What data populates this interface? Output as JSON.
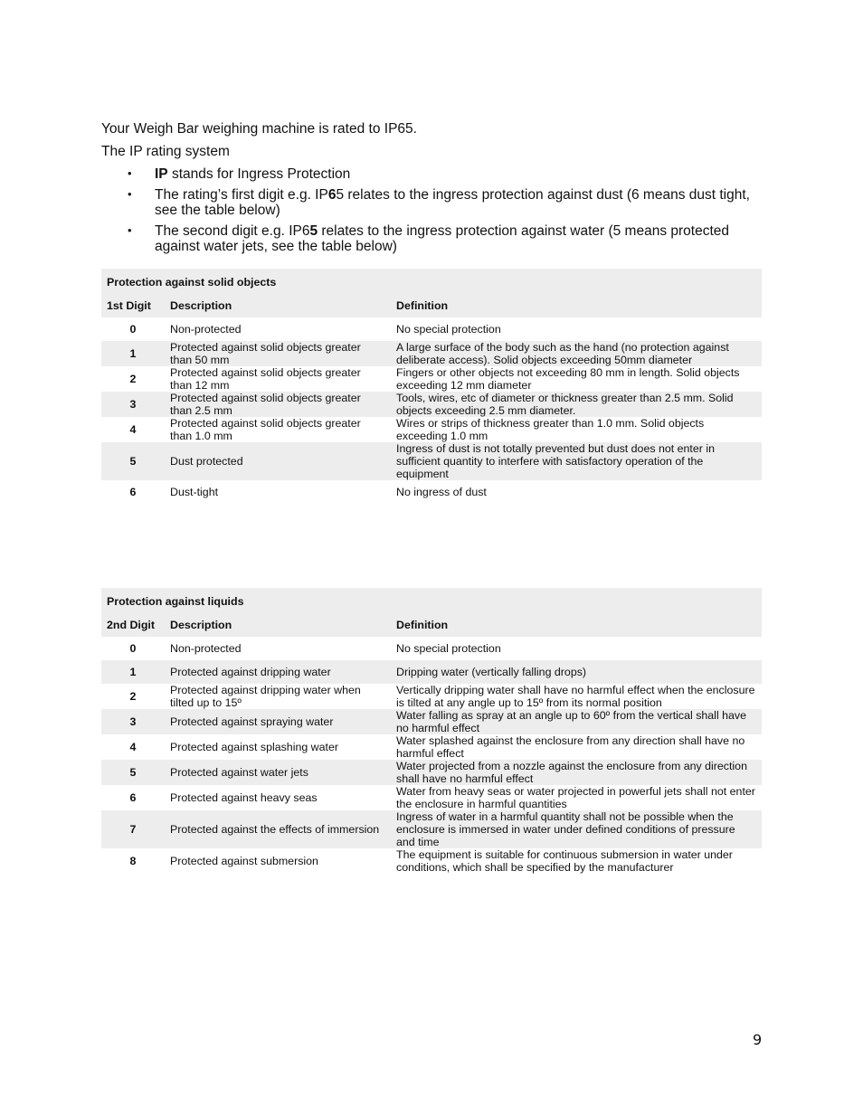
{
  "intro": {
    "line1": "Your Weigh Bar weighing machine is rated to IP65.",
    "line2": "The IP rating system",
    "bullets": [
      {
        "pre": "",
        "bold": "IP",
        "post": " stands for Ingress Protection"
      },
      {
        "pre": "The rating’s first digit e.g. IP",
        "bold": "6",
        "post": "5 relates to the ingress protection against dust (6 means dust tight, see the table below)"
      },
      {
        "pre": "The second digit e.g. IP6",
        "bold": "5",
        "post": " relates to the ingress protection against water (5 means protected against water jets, see the table below)"
      }
    ],
    "bullet_glyph": "•"
  },
  "solids_table": {
    "title": "Protection against solid objects",
    "headers": [
      "1st Digit",
      "Description",
      "Definition"
    ],
    "rows": [
      {
        "digit": "0",
        "description": "Non-protected",
        "definition": "No special protection"
      },
      {
        "digit": "1",
        "description": "Protected against solid objects greater than 50 mm",
        "definition": "A large surface of the body such as the hand (no protection against deliberate access). Solid objects exceeding 50mm diameter"
      },
      {
        "digit": "2",
        "description": "Protected against solid objects greater than 12 mm",
        "definition": "Fingers or other objects not exceeding 80 mm in length. Solid objects exceeding 12 mm diameter"
      },
      {
        "digit": "3",
        "description": "Protected against solid objects greater than 2.5 mm",
        "definition": "Tools, wires, etc of diameter or thickness greater than 2.5 mm. Solid objects exceeding 2.5 mm diameter."
      },
      {
        "digit": "4",
        "description": "Protected against solid objects greater than 1.0 mm",
        "definition": "Wires or strips of thickness greater than 1.0 mm. Solid objects exceeding 1.0 mm"
      },
      {
        "digit": "5",
        "description": "Dust protected",
        "definition": "Ingress of dust is not totally prevented but dust does not enter in sufficient quantity to interfere with satisfactory operation of the equipment"
      },
      {
        "digit": "6",
        "description": "Dust-tight",
        "definition": "No ingress of dust"
      }
    ]
  },
  "liquids_table": {
    "title": "Protection against liquids",
    "headers": [
      "2nd Digit",
      "Description",
      "Definition"
    ],
    "rows": [
      {
        "digit": "0",
        "description": "Non-protected",
        "definition": "No special protection"
      },
      {
        "digit": "1",
        "description": "Protected against dripping water",
        "definition": "Dripping water (vertically falling drops)"
      },
      {
        "digit": "2",
        "description": "Protected against dripping water when tilted up to 15º",
        "definition": "Vertically dripping water shall have no harmful effect when the enclosure is tilted at any angle up to 15º from its normal position"
      },
      {
        "digit": "3",
        "description": "Protected against spraying water",
        "definition": "Water falling as spray at an angle up to 60º  from the vertical shall have no harmful effect"
      },
      {
        "digit": "4",
        "description": "Protected against splashing water",
        "definition": "Water splashed against the enclosure from any direction shall have no harmful effect"
      },
      {
        "digit": "5",
        "description": "Protected against water jets",
        "definition": "Water projected from a nozzle against the enclosure from any direction shall have no harmful effect"
      },
      {
        "digit": "6",
        "description": "Protected against heavy seas",
        "definition": "Water from heavy seas or water projected in powerful jets shall not enter the enclosure in harmful quantities"
      },
      {
        "digit": "7",
        "description": "Protected against the effects of immersion",
        "definition": "Ingress of water in a harmful quantity shall not be possible when the enclosure is immersed in water under defined conditions of pressure and time"
      },
      {
        "digit": "8",
        "description": "Protected against submersion",
        "definition": "The equipment is suitable for continuous submersion in water under conditions, which shall be specified by the manufacturer"
      }
    ]
  },
  "page_number": "9",
  "colors": {
    "table_shade": "#ededed",
    "text": "#111111"
  }
}
